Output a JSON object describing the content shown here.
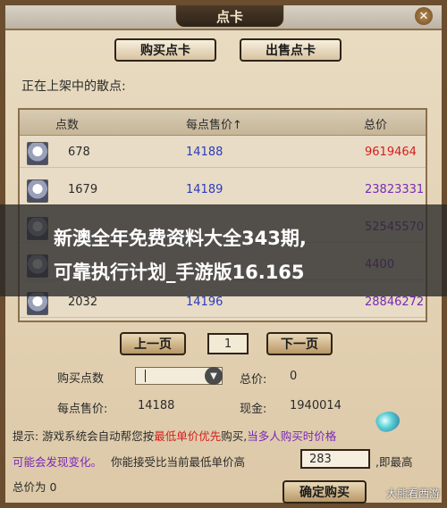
{
  "window": {
    "title": "点卡",
    "close_glyph": "✕"
  },
  "top_buttons": {
    "buy": "购买点卡",
    "sell": "出售点卡"
  },
  "list_heading": "正在上架中的散点:",
  "table": {
    "headers": {
      "qty": "点数",
      "price": "每点售价↑",
      "total": "总价"
    },
    "rows": [
      {
        "qty": "678",
        "price": "14188",
        "total": "9619464",
        "total_color": "#d41e1e"
      },
      {
        "qty": "1679",
        "price": "14189",
        "total": "23823331",
        "total_color": "#7a28b8"
      },
      {
        "qty": "",
        "price": "",
        "total": "52545570",
        "total_color": "#7a28b8"
      },
      {
        "qty": "",
        "price": "",
        "total": "4400",
        "total_color": "#7a28b8"
      },
      {
        "qty": "2032",
        "price": "14196",
        "total": "28846272",
        "total_color": "#7a28b8"
      }
    ]
  },
  "pager": {
    "prev": "上一页",
    "page": "1",
    "next": "下一页"
  },
  "buy_form": {
    "qty_label": "购买点数",
    "total_label": "总价:",
    "total_value": "0",
    "unit_price_label": "每点售价:",
    "unit_price_value": "14188",
    "cash_label": "现金:",
    "cash_value": "1940014"
  },
  "tip": {
    "prefix": "提示: 游戏系统会自动帮您按",
    "highlight": "最低单价优先",
    "mid": "购买,",
    "purple1": "当多人购买时价格",
    "purple2": "可能会发现变化。",
    "line2": "你能接受比当前最低单价高",
    "limit_value": "283",
    "suffix": ",即最高",
    "line3": "总价为 0"
  },
  "confirm_button": "确定购买",
  "overlay": {
    "line1": "新澳全年免费资料大全343期,",
    "line2": "可靠执行计划_手游版16.165"
  },
  "watermark": "大熊看西游"
}
